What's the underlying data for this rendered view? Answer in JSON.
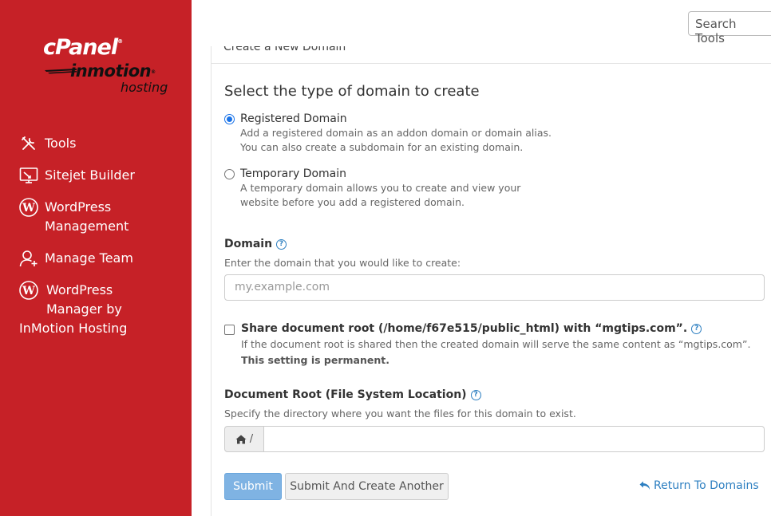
{
  "brand": {
    "cpanel": "cPanel",
    "host": "inmotion",
    "host_sub": "hosting"
  },
  "sidebar": {
    "items": [
      {
        "label": "Tools",
        "icon": "tools-icon"
      },
      {
        "label": "Sitejet Builder",
        "icon": "sitejet-icon"
      },
      {
        "label": "WordPress\nManagement",
        "icon": "wordpress-icon"
      },
      {
        "label": "Manage Team",
        "icon": "user-plus-icon"
      },
      {
        "label": "WordPress\nManager by",
        "icon": "wordpress-icon"
      }
    ],
    "last_item_tail": "InMotion Hosting"
  },
  "topbar": {
    "search_placeholder": "Search Tools"
  },
  "page": {
    "breadcrumb": "Create a New Domain",
    "heading": "Select the type of domain to create",
    "options": [
      {
        "label": "Registered Domain",
        "desc": "Add a registered domain as an addon domain or domain alias.\nYou can also create a subdomain for an existing domain.",
        "checked": true
      },
      {
        "label": "Temporary Domain",
        "desc": "A temporary domain allows you to create and view your\nwebsite before you add a registered domain.",
        "checked": false
      }
    ],
    "domain_label": "Domain",
    "domain_hint": "Enter the domain that you would like to create:",
    "domain_placeholder": "my.example.com",
    "share_label": "Share document root (/home/f67e515/public_html) with “mgtips.com”.",
    "share_desc": "If the document root is shared then the created domain will serve the same content as “mgtips.com”.",
    "share_desc_bold": "This setting is permanent.",
    "docroot_label": "Document Root (File System Location)",
    "docroot_hint": "Specify the directory where you want the files for this domain to exist.",
    "docroot_prefix": "/",
    "docroot_value": "",
    "submit": "Submit",
    "submit_another": "Submit And Create Another",
    "return": "Return To Domains"
  },
  "colors": {
    "sidebar": "#c62127",
    "link": "#2d7fc1",
    "primary_button": "#7fb3e3"
  }
}
